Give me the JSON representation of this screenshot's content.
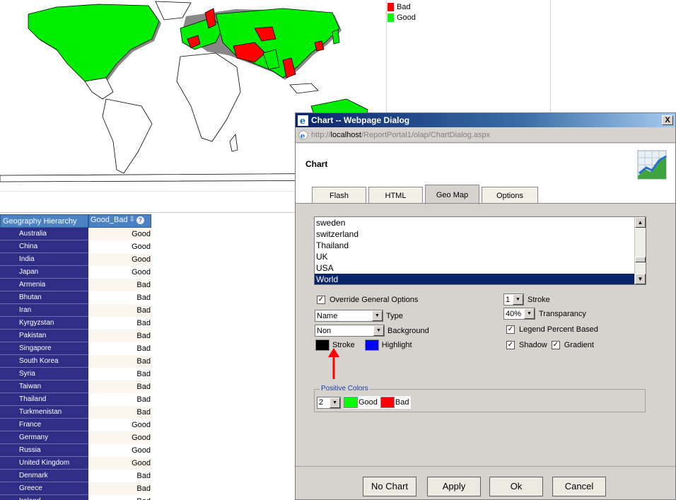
{
  "legend": {
    "items": [
      {
        "label": "Bad",
        "color": "#ff0000"
      },
      {
        "label": "Good",
        "color": "#00ff00"
      }
    ]
  },
  "grid": {
    "headers": {
      "hierarchy": "Geography Hierarchy",
      "measure": "Good_Bad"
    },
    "rows": [
      {
        "country": "Australia",
        "value": "Good"
      },
      {
        "country": "China",
        "value": "Good"
      },
      {
        "country": "India",
        "value": "Good"
      },
      {
        "country": "Japan",
        "value": "Good"
      },
      {
        "country": "Armenia",
        "value": "Bad"
      },
      {
        "country": "Bhutan",
        "value": "Bad"
      },
      {
        "country": "Iran",
        "value": "Bad"
      },
      {
        "country": "Kyrgyzstan",
        "value": "Bad"
      },
      {
        "country": "Pakistan",
        "value": "Bad"
      },
      {
        "country": "Singapore",
        "value": "Bad"
      },
      {
        "country": "South Korea",
        "value": "Bad"
      },
      {
        "country": "Syria",
        "value": "Bad"
      },
      {
        "country": "Taiwan",
        "value": "Bad"
      },
      {
        "country": "Thailand",
        "value": "Bad"
      },
      {
        "country": "Turkmenistan",
        "value": "Bad"
      },
      {
        "country": "France",
        "value": "Good"
      },
      {
        "country": "Germany",
        "value": "Good"
      },
      {
        "country": "Russia",
        "value": "Good"
      },
      {
        "country": "United Kingdom",
        "value": "Good"
      },
      {
        "country": "Denmark",
        "value": "Bad"
      },
      {
        "country": "Greece",
        "value": "Bad"
      },
      {
        "country": "Ireland",
        "value": "Bad"
      }
    ]
  },
  "dialog": {
    "title": "Chart -- Webpage Dialog",
    "close_label": "X",
    "url_prefix": "http://",
    "url_host": "localhost",
    "url_path": "/ReportPortal1/olap/ChartDialog.aspx",
    "heading": "Chart",
    "tabs": [
      {
        "label": "Flash"
      },
      {
        "label": "HTML"
      },
      {
        "label": "Geo Map"
      },
      {
        "label": "Options"
      }
    ],
    "map_list": [
      "sweden",
      "switzerland",
      "Thailand",
      "UK",
      "USA",
      "World"
    ],
    "override_label": "Override General Options",
    "type_label": "Type",
    "type_value": "Name",
    "background_label": "Background",
    "background_value": "Non",
    "stroke_color_label": "Stroke",
    "highlight_label": "Highlight",
    "stroke_width_value": "1",
    "stroke_width_label": "Stroke",
    "transparency_value": "40%",
    "transparency_label": "Transparancy",
    "legend_percent_label": "Legend Percent Based",
    "shadow_label": "Shadow",
    "gradient_label": "Gradient",
    "positive_colors_label": "Positive Colors",
    "positive_count": "2",
    "good_label": "Good",
    "bad_label": "Bad",
    "buttons": {
      "no_chart": "No Chart",
      "apply": "Apply",
      "ok": "Ok",
      "cancel": "Cancel"
    }
  },
  "colors": {
    "good": "#00ff00",
    "bad": "#ff0000",
    "stroke": "#000000",
    "highlight": "#0000ff",
    "grid_header": "#4a82c4",
    "grid_row": "#2e2e87",
    "selection": "#0a246a"
  }
}
